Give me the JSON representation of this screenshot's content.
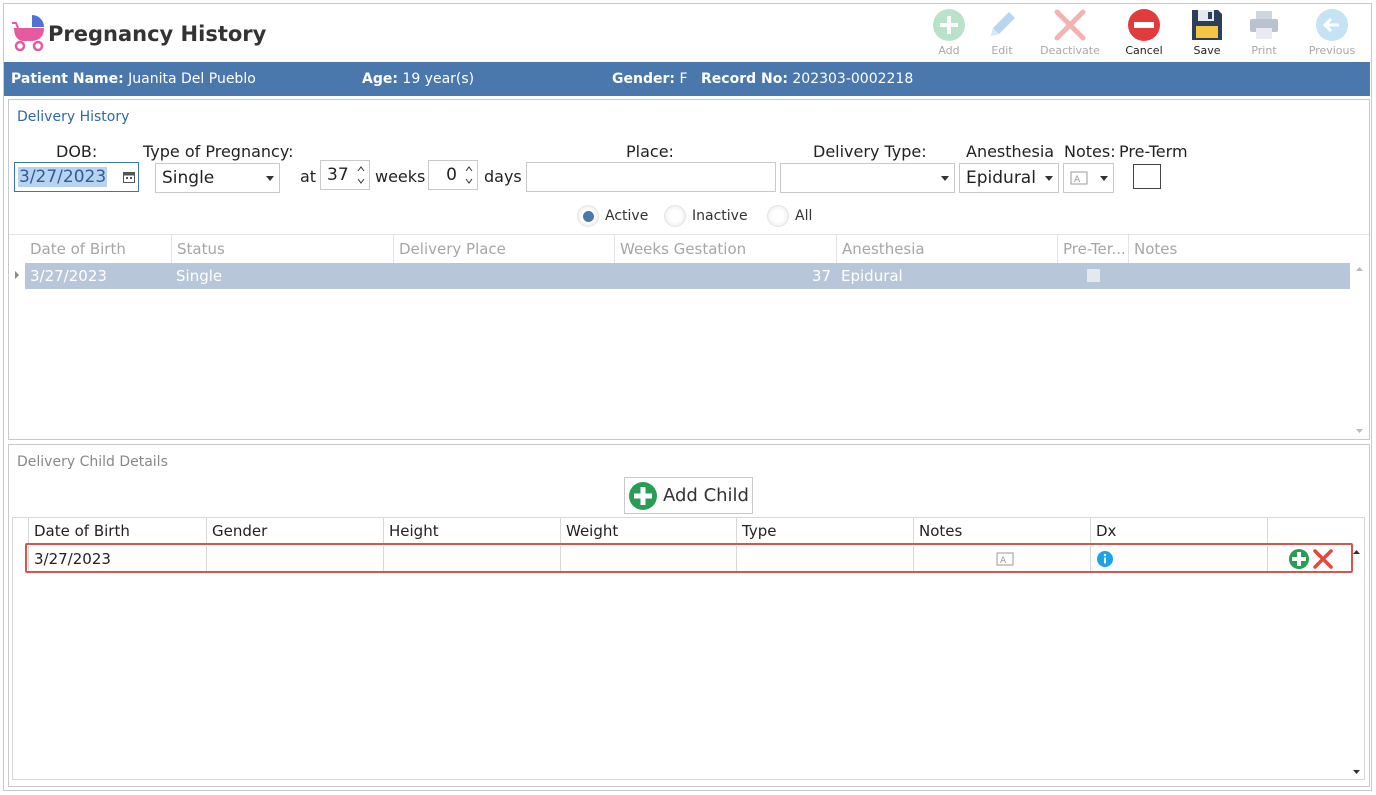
{
  "header": {
    "title": "Pregnancy History",
    "toolbar": [
      {
        "key": "add",
        "label": "Add",
        "icon": "add-icon",
        "enabled": false
      },
      {
        "key": "edit",
        "label": "Edit",
        "icon": "pencil-icon",
        "enabled": false
      },
      {
        "key": "deactivate",
        "label": "Deactivate",
        "icon": "x-icon",
        "enabled": false
      },
      {
        "key": "cancel",
        "label": "Cancel",
        "icon": "no-entry-icon",
        "enabled": true
      },
      {
        "key": "save",
        "label": "Save",
        "icon": "floppy-disk-icon",
        "enabled": true
      },
      {
        "key": "print",
        "label": "Print",
        "icon": "printer-icon",
        "enabled": false
      },
      {
        "key": "previous",
        "label": "Previous",
        "icon": "arrow-left-icon",
        "enabled": false
      }
    ]
  },
  "patient": {
    "name_label": "Patient Name:",
    "name": "Juanita Del Pueblo",
    "age_label": "Age:",
    "age": "19 year(s)",
    "gender_label": "Gender:",
    "gender": "F",
    "record_label": "Record No:",
    "record": "202303-0002218"
  },
  "delivery": {
    "section_title": "Delivery History",
    "labels": {
      "dob": "DOB:",
      "type": "Type of Pregnancy:",
      "at": "at",
      "weeks": "weeks",
      "days": "days",
      "place": "Place:",
      "delivery_type": "Delivery Type:",
      "anesthesia": "Anesthesia",
      "notes": "Notes:",
      "preterm": "Pre-Term"
    },
    "values": {
      "dob": "3/27/2023",
      "type": "Single",
      "weeks": "37",
      "days": "0",
      "place": "",
      "delivery_type": "",
      "anesthesia": "Epidural",
      "preterm": false
    },
    "filters": [
      {
        "label": "Active",
        "selected": true
      },
      {
        "label": "Inactive",
        "selected": false
      },
      {
        "label": "All",
        "selected": false
      }
    ],
    "grid": {
      "columns": [
        "Date of Birth",
        "Status",
        "Delivery Place",
        "Weeks Gestation",
        "Anesthesia",
        "Pre-Ter...",
        "Notes"
      ],
      "rows": [
        {
          "dob": "3/27/2023",
          "status": "Single",
          "place": "",
          "weeks": "37",
          "anesthesia": "Epidural",
          "preterm": false,
          "notes": ""
        }
      ]
    }
  },
  "child": {
    "section_title": "Delivery Child Details",
    "add_label": "Add Child",
    "columns": [
      "Date of Birth",
      "Gender",
      "Height",
      "Weight",
      "Type",
      "Notes",
      "Dx"
    ],
    "rows": [
      {
        "dob": "3/27/2023",
        "gender": "",
        "height": "",
        "weight": "",
        "type": "",
        "notes_icon": "note-icon",
        "dx_icon": "info-icon"
      }
    ]
  },
  "colors": {
    "accent": "#4a78ad",
    "selected_row": "#b8c6d9",
    "highlight_border": "#d9534f",
    "add_green": "#2a9d55",
    "delete_red": "#e8453c",
    "cancel_red": "#e23b3b",
    "info_blue": "#1aa3e8"
  }
}
